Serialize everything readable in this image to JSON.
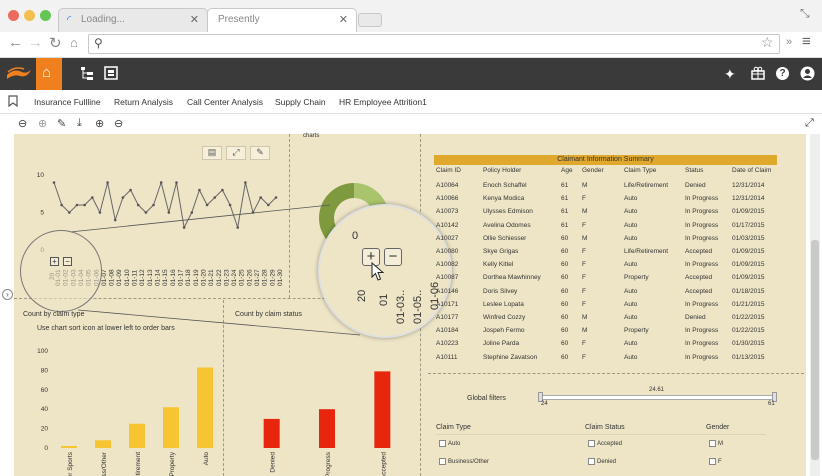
{
  "browser": {
    "tabs": [
      {
        "label": "Loading..."
      },
      {
        "label": "Presently"
      }
    ]
  },
  "menu": {
    "items": [
      "Insurance Fullline",
      "Return Analysis",
      "Call Center Analysis",
      "Supply Chain",
      "HR Employee Attrition1"
    ]
  },
  "line_chart": {
    "y_ticks": [
      "10",
      "5",
      "0"
    ],
    "x_labels": [
      "01-01",
      "01-02",
      "01-03",
      "01-04",
      "01-05",
      "01-06",
      "01-07",
      "01-08",
      "01-09",
      "01-10",
      "01-11",
      "01-12",
      "01-13",
      "01-14",
      "01-15",
      "01-16",
      "01-17",
      "01-18",
      "01-19",
      "01-20",
      "01-21",
      "01-22",
      "01-23",
      "01-24",
      "01-25",
      "01-26",
      "01-27",
      "01-28",
      "01-29",
      "01-30"
    ],
    "x_prefix": "20",
    "charts_label": "charts"
  },
  "magnifier": {
    "zero_label": "0",
    "tick_labels": [
      "20",
      "01",
      "01-03..",
      "01-05..",
      "01-06"
    ],
    "plus": "+",
    "minus": "−"
  },
  "claims_table": {
    "title": "Claimant Information Summary",
    "columns": [
      "Claim ID",
      "Policy Holder",
      "Age",
      "Gender",
      "Claim Type",
      "Status",
      "Date of Claim"
    ],
    "rows": [
      [
        "A10064",
        "Enoch Schaffel",
        "61",
        "M",
        "Life/Retirement",
        "Denied",
        "12/31/2014"
      ],
      [
        "A10066",
        "Kenya Modica",
        "61",
        "F",
        "Auto",
        "In Progress",
        "12/31/2014"
      ],
      [
        "A10073",
        "Ulysses Edmison",
        "61",
        "M",
        "Auto",
        "In Progress",
        "01/09/2015"
      ],
      [
        "A10142",
        "Avelina Odomes",
        "61",
        "F",
        "Auto",
        "In Progress",
        "01/17/2015"
      ],
      [
        "A10027",
        "Ollie Schiesser",
        "60",
        "M",
        "Auto",
        "In Progress",
        "01/03/2015"
      ],
      [
        "A10080",
        "Skye Grigas",
        "60",
        "F",
        "Life/Retirement",
        "Accepted",
        "01/09/2015"
      ],
      [
        "A10082",
        "Kelly Kittel",
        "60",
        "F",
        "Auto",
        "In Progress",
        "01/09/2015"
      ],
      [
        "A10087",
        "Dorthea Mawhinney",
        "60",
        "F",
        "Property",
        "Accepted",
        "01/09/2015"
      ],
      [
        "A10146",
        "Doris Silvey",
        "60",
        "F",
        "Auto",
        "Accepted",
        "01/18/2015"
      ],
      [
        "A10171",
        "Leslee Lopata",
        "60",
        "F",
        "Auto",
        "In Progress",
        "01/21/2015"
      ],
      [
        "A10177",
        "Winfred Cozzy",
        "60",
        "M",
        "Auto",
        "Denied",
        "01/22/2015"
      ],
      [
        "A10184",
        "Jospeh Fermo",
        "60",
        "M",
        "Property",
        "In Progress",
        "01/22/2015"
      ],
      [
        "A10223",
        "Joline Parda",
        "60",
        "F",
        "Auto",
        "In Progress",
        "01/30/2015"
      ],
      [
        "A10111",
        "Stephine Zavatson",
        "60",
        "F",
        "Auto",
        "In Progress",
        "01/13/2015"
      ]
    ]
  },
  "global_filters": {
    "label": "Global filters",
    "slider_min": "24",
    "slider_max": "61",
    "slider_value": "24.61",
    "groups": [
      {
        "title": "Claim Type",
        "options": [
          "Auto",
          "Business/Other"
        ]
      },
      {
        "title": "Claim Status",
        "options": [
          "Accepted",
          "Denied"
        ]
      },
      {
        "title": "Gender",
        "options": [
          "M",
          "F"
        ]
      }
    ]
  },
  "colors": {
    "accent_orange": "#f07f1d",
    "bar_yellow": "#f7c531",
    "bar_red": "#e8250d",
    "table_header": "#e0a82c",
    "dashboard_bg": "#eee5c7"
  },
  "chart_data": [
    {
      "type": "line",
      "title": "",
      "x": [
        "01-01",
        "01-02",
        "01-03",
        "01-04",
        "01-05",
        "01-06",
        "01-07",
        "01-08",
        "01-09",
        "01-10",
        "01-11",
        "01-12",
        "01-13",
        "01-14",
        "01-15",
        "01-16",
        "01-17",
        "01-18",
        "01-19",
        "01-20",
        "01-21",
        "01-22",
        "01-23",
        "01-24",
        "01-25",
        "01-26",
        "01-27",
        "01-28",
        "01-29",
        "01-30"
      ],
      "values": [
        9,
        6,
        5,
        6,
        6,
        7,
        5,
        9,
        4,
        7,
        8,
        6,
        5,
        6,
        9,
        5,
        9,
        3,
        5,
        8,
        6,
        7,
        8,
        6,
        3,
        9,
        5,
        7,
        6,
        7
      ],
      "ylim": [
        0,
        12
      ],
      "yticks": [
        0,
        5,
        10
      ]
    },
    {
      "type": "bar",
      "title": "Count by claim type",
      "subtitle": "Use chart sort icon at lower left to order bars",
      "categories": [
        "Other Sports",
        "Business/Other",
        "Life/Retirement",
        "Property",
        "Auto"
      ],
      "values": [
        2,
        8,
        25,
        42,
        83
      ],
      "ylim": [
        0,
        100
      ],
      "yticks": [
        0,
        20,
        40,
        60,
        80,
        100
      ]
    },
    {
      "type": "bar",
      "title": "Count by claim status",
      "categories": [
        "Denied",
        "In Progress",
        "Accepted"
      ],
      "values": [
        30,
        40,
        79
      ],
      "ylim": [
        0,
        100
      ],
      "yticks": [
        0,
        20,
        40,
        60,
        80,
        100
      ]
    }
  ]
}
